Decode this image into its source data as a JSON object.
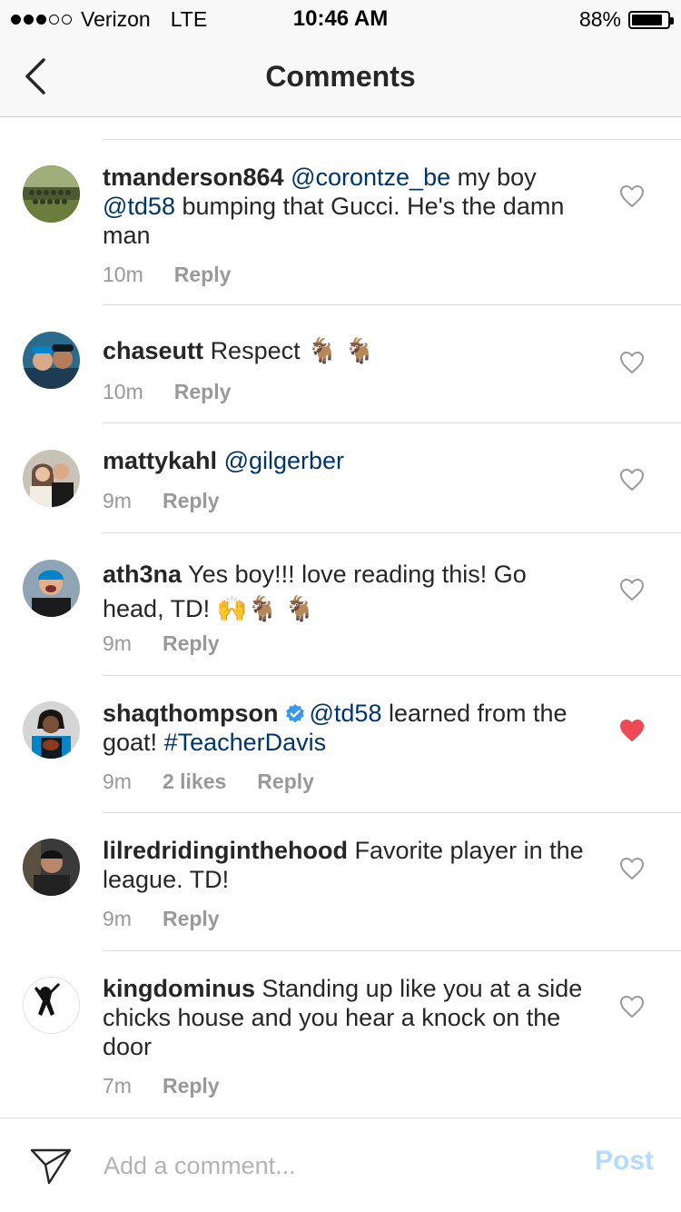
{
  "status_bar": {
    "carrier": "Verizon",
    "network": "LTE",
    "time": "10:46 AM",
    "battery": "88%",
    "battery_level": 0.88
  },
  "nav": {
    "title": "Comments",
    "back_icon": "chevron-left-icon"
  },
  "comments": [
    {
      "username": "tmanderson864",
      "segments": [
        {
          "text": "@corontze_be",
          "link": true
        },
        {
          "text": " my boy ",
          "link": false
        },
        {
          "text": "@td58",
          "link": true
        },
        {
          "text": " bumping that Gucci. He's the damn man",
          "link": false
        }
      ],
      "time": "10m",
      "reply": "Reply",
      "liked": false
    },
    {
      "username": "chaseutt",
      "segments": [
        {
          "text": "Respect 🐐 🐐",
          "link": false
        }
      ],
      "time": "10m",
      "reply": "Reply",
      "liked": false
    },
    {
      "username": "mattykahl",
      "segments": [
        {
          "text": "@gilgerber",
          "link": true
        }
      ],
      "time": "9m",
      "reply": "Reply",
      "liked": false
    },
    {
      "username": "ath3na",
      "segments": [
        {
          "text": "Yes boy!!! love reading this! Go head, TD! 🙌🐐 🐐",
          "link": false
        }
      ],
      "time": "9m",
      "reply": "Reply",
      "liked": false
    },
    {
      "username": "shaqthompson",
      "verified": true,
      "segments": [
        {
          "text": "@td58",
          "link": true
        },
        {
          "text": " learned from the goat! ",
          "link": false
        },
        {
          "text": "#TeacherDavis",
          "link": true
        }
      ],
      "time": "9m",
      "likes": "2 likes",
      "reply": "Reply",
      "liked": true
    },
    {
      "username": "lilredridinginthehood",
      "segments": [
        {
          "text": "Favorite player in the league. TD!",
          "link": false
        }
      ],
      "time": "9m",
      "reply": "Reply",
      "liked": false
    },
    {
      "username": "kingdominus",
      "segments": [
        {
          "text": "Standing up like you at a side chicks house and you hear a knock on the door",
          "link": false
        }
      ],
      "time": "7m",
      "reply": "Reply",
      "liked": false
    }
  ],
  "footer": {
    "placeholder": "Add a comment...",
    "post_label": "Post",
    "send_icon": "send-icon"
  },
  "colors": {
    "link": "#003569",
    "muted": "#999999",
    "liked_heart": "#ed4956",
    "post_disabled": "#b3dbff",
    "verified": "#3897f0"
  }
}
